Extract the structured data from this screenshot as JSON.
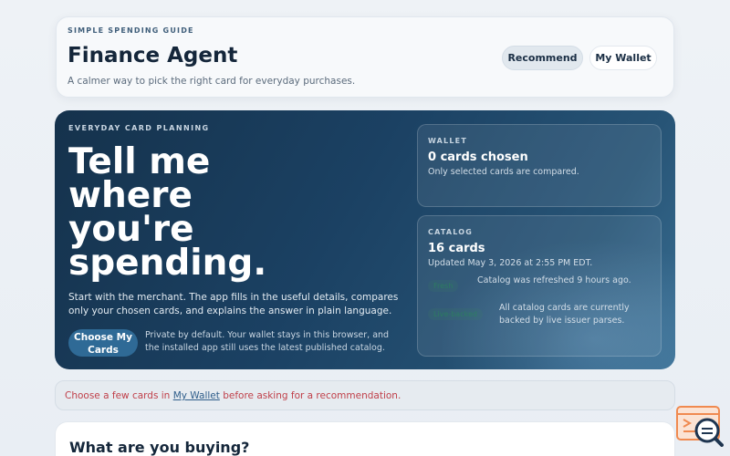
{
  "header": {
    "eyebrow": "SIMPLE SPENDING GUIDE",
    "title": "Finance Agent",
    "subtitle": "A calmer way to pick the right card for everyday purchases.",
    "nav": {
      "recommend": "Recommend",
      "wallet": "My Wallet"
    }
  },
  "hero": {
    "eyebrow": "EVERYDAY CARD PLANNING",
    "headline": "Tell me\nwhere\nyou're\nspending.",
    "description": "Start with the merchant. The app fills in the useful details, compares only your chosen cards, and explains the answer in plain language.",
    "cta": "Choose My Cards",
    "privacy": "Private by default. Your wallet stays in this browser, and the installed app still uses the latest published catalog."
  },
  "wallet_panel": {
    "label": "WALLET",
    "value": "0 cards chosen",
    "note": "Only selected cards are compared."
  },
  "catalog_panel": {
    "label": "CATALOG",
    "value": "16 cards",
    "updated": "Updated May 3, 2026 at 2:55 PM EDT.",
    "status1_badge": "Fresh",
    "status1_text": "Catalog was refreshed 9 hours ago.",
    "status2_badge": "Live-backed",
    "status2_text": "All catalog cards are currently backed by live issuer parses."
  },
  "warning": {
    "prefix": "Choose a few cards in ",
    "link": "My Wallet",
    "suffix": " before asking for a recommendation."
  },
  "buy": {
    "title": "What are you buying?"
  },
  "colors": {
    "hero_dark": "#15324c",
    "warning_text": "#c0404a",
    "logo_orange": "#f08a50",
    "logo_navy": "#1e3550"
  }
}
